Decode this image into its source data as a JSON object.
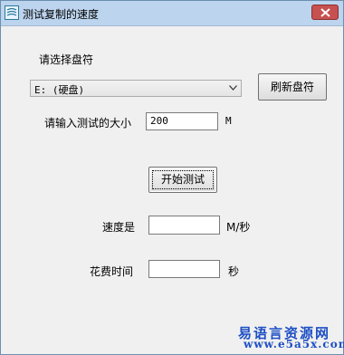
{
  "window": {
    "title": "测试复制的速度",
    "accent": "#bcd4ee",
    "close_color": "#c75050"
  },
  "drive": {
    "label": "请选择盘符",
    "selected": "E: (硬盘)",
    "refresh_label": "刷新盘符"
  },
  "size": {
    "label": "请输入测试的大小",
    "value": "200",
    "unit": "M"
  },
  "start": {
    "label": "开始测试"
  },
  "speed": {
    "label": "速度是",
    "value": "",
    "unit": "M/秒"
  },
  "time": {
    "label": "花费时间",
    "value": "",
    "unit": "秒"
  },
  "watermark": {
    "line1": "易语言资源网",
    "line2": "www.e5a5x.com"
  }
}
